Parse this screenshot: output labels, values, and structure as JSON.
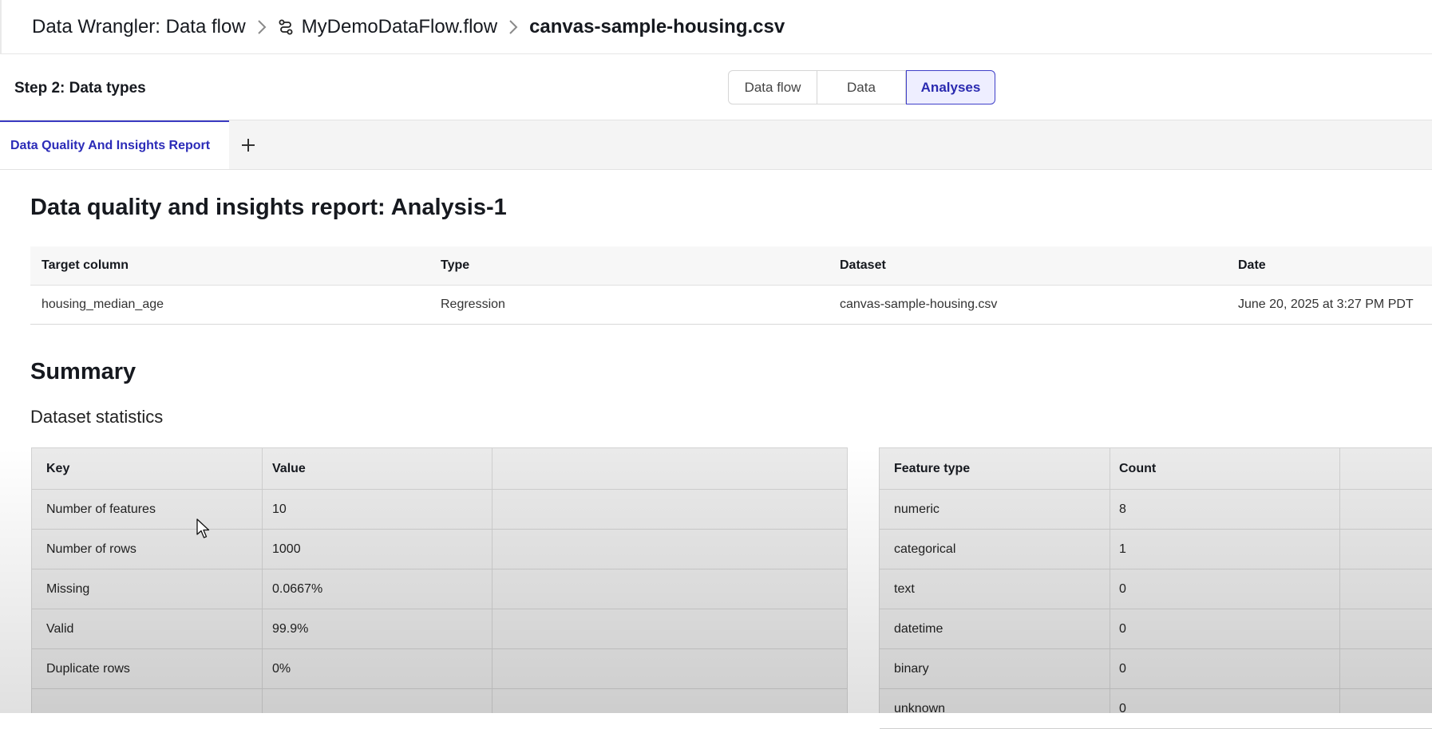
{
  "breadcrumb": {
    "root": "Data Wrangler: Data flow",
    "flow": "MyDemoDataFlow.flow",
    "current": "canvas-sample-housing.csv"
  },
  "step": {
    "title": "Step 2: Data types",
    "views": [
      "Data flow",
      "Data",
      "Analyses"
    ],
    "active_view": "Analyses"
  },
  "tabs": {
    "active": "Data Quality And Insights Report",
    "add_icon": "plus-icon"
  },
  "report": {
    "title": "Data quality and insights report: Analysis-1",
    "meta_headers": [
      "Target column",
      "Type",
      "Dataset",
      "Date"
    ],
    "meta_values": [
      "housing_median_age",
      "Regression",
      "canvas-sample-housing.csv",
      "June 20, 2025 at 3:27 PM PDT"
    ],
    "summary_heading": "Summary",
    "stats_heading": "Dataset statistics"
  },
  "dataset_statistics": {
    "headers": [
      "Key",
      "Value"
    ],
    "rows": [
      [
        "Number of features",
        "10"
      ],
      [
        "Number of rows",
        "1000"
      ],
      [
        "Missing",
        "0.0667%"
      ],
      [
        "Valid",
        "99.9%"
      ],
      [
        "Duplicate rows",
        "0%"
      ]
    ]
  },
  "feature_types": {
    "headers": [
      "Feature type",
      "Count"
    ],
    "rows": [
      [
        "numeric",
        "8"
      ],
      [
        "categorical",
        "1"
      ],
      [
        "text",
        "0"
      ],
      [
        "datetime",
        "0"
      ],
      [
        "binary",
        "0"
      ],
      [
        "unknown",
        "0"
      ]
    ]
  },
  "colors": {
    "accent": "#3b3bc2",
    "accent_bg": "#eeeeff"
  }
}
